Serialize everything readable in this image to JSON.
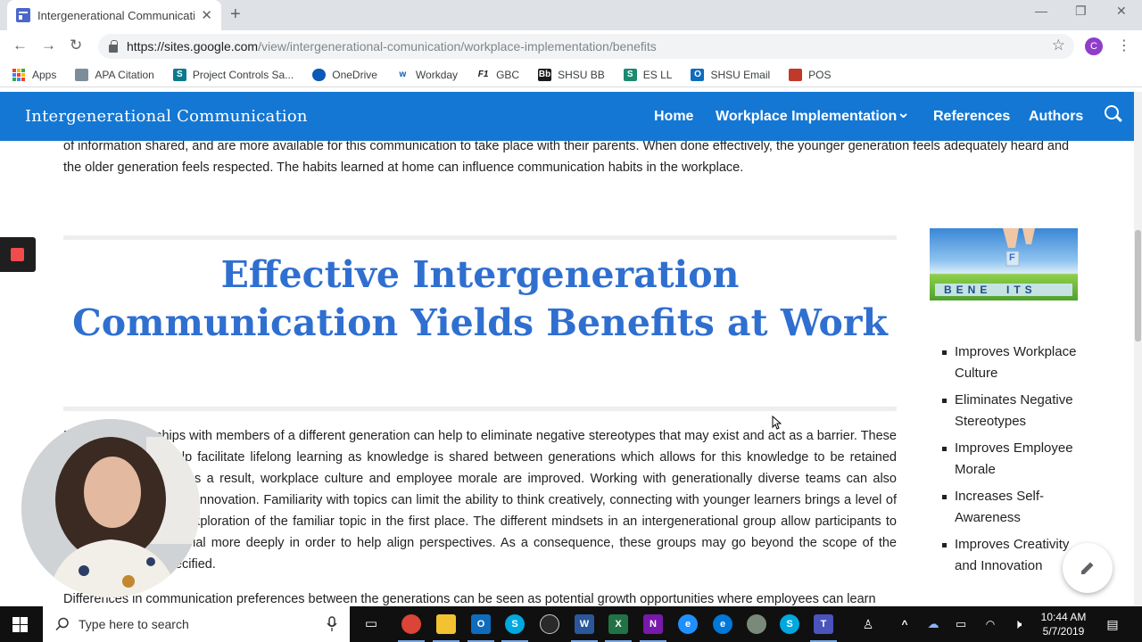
{
  "browser": {
    "tab_title": "Intergenerational Communicatio",
    "tab_close": "✕",
    "new_tab": "+",
    "url_host": "https://sites.google.com",
    "url_path": "/view/intergenerational-comunication/workplace-implementation/benefits",
    "profile_initial": "C"
  },
  "bookmarks": [
    {
      "label": "Apps",
      "icon": "apps-grid-icon"
    },
    {
      "label": "APA Citation",
      "icon": "apa-icon",
      "color": "#7d8c99"
    },
    {
      "label": "Project Controls Sa...",
      "icon": "sharepoint-icon",
      "color": "#0b7a8c"
    },
    {
      "label": "OneDrive",
      "icon": "onedrive-icon",
      "color": "#0a5ab6"
    },
    {
      "label": "Workday",
      "icon": "workday-icon",
      "color": "#f5a623"
    },
    {
      "label": "GBC",
      "icon": "f1-icon",
      "color": "#202124"
    },
    {
      "label": "SHSU BB",
      "icon": "blackboard-icon",
      "color": "#1a1a1a"
    },
    {
      "label": "ES LL",
      "icon": "es-icon",
      "color": "#1a8a70"
    },
    {
      "label": "SHSU Email",
      "icon": "outlook-icon",
      "color": "#0f6cbd"
    },
    {
      "label": "POS",
      "icon": "pos-icon",
      "color": "#c0392b"
    }
  ],
  "site": {
    "title": "Intergenerational Communication",
    "nav": [
      "Home",
      "Workplace Implementation",
      "References",
      "Authors"
    ],
    "nav_dropdown": "⌄"
  },
  "content": {
    "intro": "of information shared, and are more available for this communication to take place with their parents. When done effectively, the younger generation feels adequately heard and the older generation feels respected. The habits learned at home can influence communication habits in the workplace.",
    "heading": "Effective Intergeneration Communication Yields Benefits at Work",
    "paragraph1": "Building relationships with members of a different generation can help to eliminate negative stereotypes that may exist and act as a barrier. These relationships can help facilitate lifelong learning as knowledge is shared between generations which allows for this knowledge to be retained within the company. As a result, workplace culture and employee morale are improved. Working with generationally diverse teams can also increase creativity and innovation. Familiarity with topics can limit the ability to think creatively, connecting with younger learners brings a level of curiosity that lead to exploration of the familiar topic in the first place. The different mindsets in an intergenerational group allow participants to discuss training material more deeply in order to help align perspectives. As a consequence, these groups may go beyond the scope of the training program specified.",
    "paragraph2": "Differences in communication preferences between the generations can be seen as potential growth opportunities where employees can learn",
    "image_letters": "BENE  ITS",
    "image_block_letter": "F",
    "benefits": [
      "Improves Workplace Culture",
      "Eliminates Negative Stereotypes",
      "Improves Employee Morale",
      "Increases Self-Awareness",
      "Improves Creativity and Innovation"
    ]
  },
  "taskbar": {
    "search_placeholder": "Type here to search",
    "time": "10:44 AM",
    "date": "5/7/2019"
  }
}
